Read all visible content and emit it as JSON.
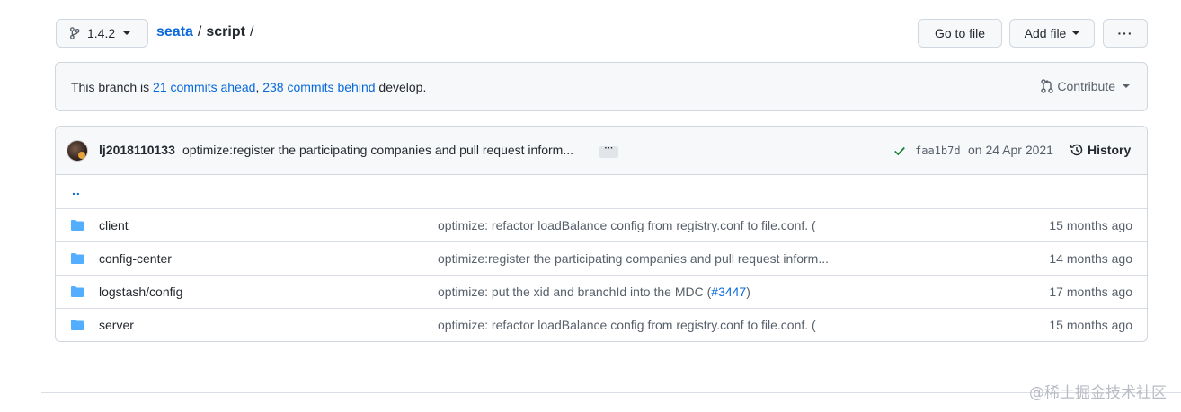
{
  "header": {
    "branch": "1.4.2",
    "repo": "seata",
    "path_sep": "/",
    "folder": "script",
    "trail_sep": "/",
    "goto_file": "Go to file",
    "add_file": "Add file",
    "more": "···"
  },
  "branch_info": {
    "prefix": "This branch is",
    "ahead": "21 commits ahead",
    "comma": ",",
    "behind": "238 commits behind",
    "suffix": "develop.",
    "contribute": "Contribute"
  },
  "latest_commit": {
    "author": "lj2018110133",
    "message": "optimize:register the participating companies and pull request inform...",
    "ellipsis": "···",
    "sha": "faa1b7d",
    "date": "on 24 Apr 2021",
    "history": "History"
  },
  "up_link": "..",
  "files": [
    {
      "name": "client",
      "message": "optimize: refactor loadBalance config from registry.conf to file.conf. (",
      "issue": "",
      "issue_close": "",
      "age": "15 months ago"
    },
    {
      "name": "config-center",
      "message": "optimize:register the participating companies and pull request inform...",
      "issue": "",
      "issue_close": "",
      "age": "14 months ago"
    },
    {
      "name": "logstash/config",
      "message": "optimize: put the xid and branchId into the MDC (",
      "issue": "#3447",
      "issue_close": ")",
      "age": "17 months ago"
    },
    {
      "name": "server",
      "message": "optimize: refactor loadBalance config from registry.conf to file.conf. (",
      "issue": "",
      "issue_close": "",
      "age": "15 months ago"
    }
  ],
  "watermark": "@稀土掘金技术社区",
  "colors": {
    "link": "#0969da",
    "folder": "#54aeff",
    "success": "#1a7f37"
  }
}
